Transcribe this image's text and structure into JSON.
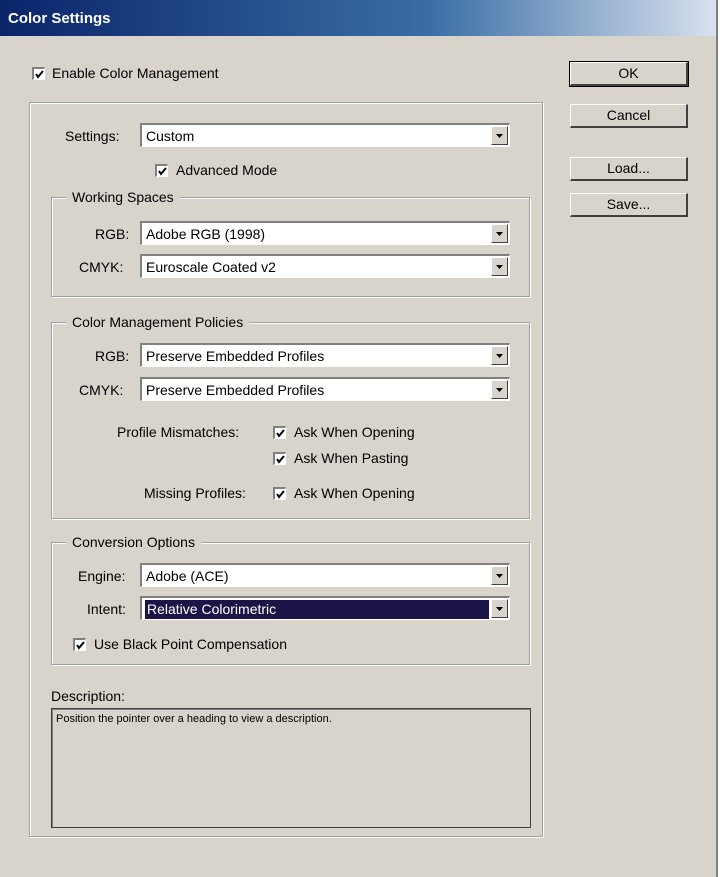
{
  "window": {
    "title": "Color Settings"
  },
  "enable_color_management": {
    "label": "Enable Color Management",
    "checked": true
  },
  "settings": {
    "label": "Settings:",
    "value": "Custom"
  },
  "advanced_mode": {
    "label": "Advanced Mode",
    "checked": true
  },
  "working_spaces": {
    "title": "Working Spaces",
    "rgb_label": "RGB:",
    "rgb_value": "Adobe RGB (1998)",
    "cmyk_label": "CMYK:",
    "cmyk_value": "Euroscale Coated v2"
  },
  "policies": {
    "title": "Color Management Policies",
    "rgb_label": "RGB:",
    "rgb_value": "Preserve Embedded Profiles",
    "cmyk_label": "CMYK:",
    "cmyk_value": "Preserve Embedded Profiles",
    "mismatch_label": "Profile Mismatches:",
    "ask_opening_label": "Ask When Opening",
    "ask_opening_checked": true,
    "ask_pasting_label": "Ask When Pasting",
    "ask_pasting_checked": true,
    "missing_label": "Missing Profiles:",
    "missing_ask_label": "Ask When Opening",
    "missing_ask_checked": true
  },
  "conversion": {
    "title": "Conversion Options",
    "engine_label": "Engine:",
    "engine_value": "Adobe (ACE)",
    "intent_label": "Intent:",
    "intent_value": "Relative Colorimetric",
    "bpc_label": "Use Black Point Compensation",
    "bpc_checked": true
  },
  "description": {
    "label": "Description:",
    "text": "Position the pointer over a heading to view a description."
  },
  "buttons": {
    "ok": "OK",
    "cancel": "Cancel",
    "load": "Load...",
    "save": "Save..."
  },
  "colors": {
    "title_bar": "#0a246a",
    "dialog_bg": "#d8d4cc",
    "selection": "#1b1547"
  }
}
